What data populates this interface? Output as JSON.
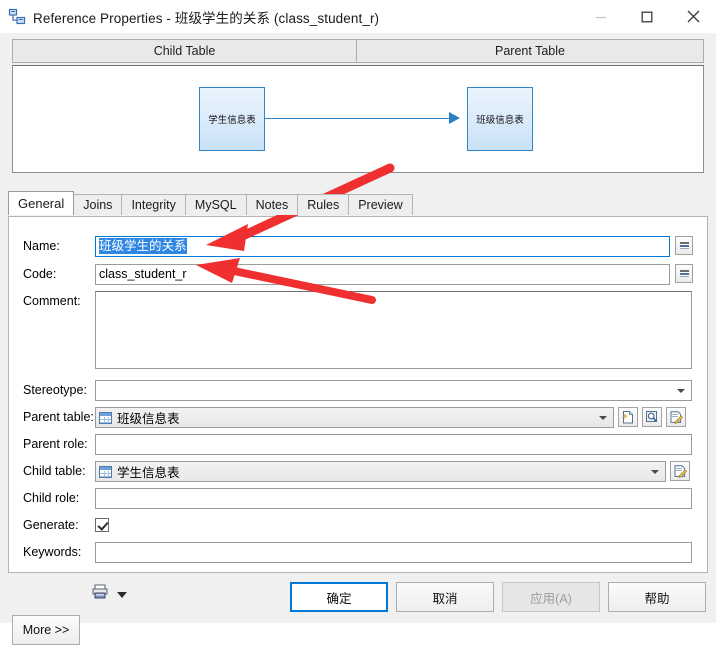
{
  "window": {
    "title": "Reference Properties - 班级学生的关系 (class_student_r)",
    "icon": "reference-icon",
    "minimize": "—",
    "maximize": "☐",
    "close": "✕"
  },
  "diagram": {
    "child_header": "Child Table",
    "parent_header": "Parent Table",
    "child_entity": "学生信息表",
    "parent_entity": "班级信息表",
    "link_color": "#2e86c8",
    "entity_fill": "#dcecfa"
  },
  "tabs": [
    {
      "label": "General",
      "active": true
    },
    {
      "label": "Joins",
      "active": false
    },
    {
      "label": "Integrity",
      "active": false
    },
    {
      "label": "MySQL",
      "active": false
    },
    {
      "label": "Notes",
      "active": false
    },
    {
      "label": "Rules",
      "active": false
    },
    {
      "label": "Preview",
      "active": false
    }
  ],
  "form": {
    "name": {
      "label": "Name:",
      "value": "班级学生的关系",
      "selected": true
    },
    "code": {
      "label": "Code:",
      "value": "class_student_r"
    },
    "comment": {
      "label": "Comment:",
      "value": ""
    },
    "stereotype": {
      "label": "Stereotype:",
      "value": ""
    },
    "parent_table": {
      "label": "Parent table:",
      "value": "班级信息表"
    },
    "parent_role": {
      "label": "Parent role:",
      "value": ""
    },
    "child_table": {
      "label": "Child table:",
      "value": "学生信息表"
    },
    "child_role": {
      "label": "Child role:",
      "value": ""
    },
    "generate": {
      "label": "Generate:",
      "checked": true
    },
    "keywords": {
      "label": "Keywords:",
      "value": ""
    }
  },
  "buttons": {
    "more": "More >>",
    "print": "print-icon",
    "ok": "确定",
    "cancel": "取消",
    "apply": "应用(A)",
    "help": "帮助"
  },
  "annotations": {
    "color": "#f03030",
    "arrow_name_target": "Name field",
    "arrow_code_target": "Code field"
  }
}
